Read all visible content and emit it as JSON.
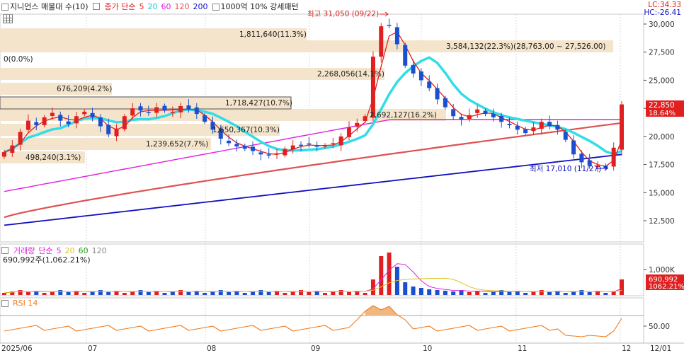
{
  "header": {
    "title": "지니언스 매물대 수(10)",
    "ma_prefix": "종가 단순",
    "ma_periods": [
      "5",
      "20",
      "60",
      "120",
      "200"
    ],
    "ma_colors": [
      "#e02020",
      "#22d0e0",
      "#e020e0",
      "#e05050",
      "#1010c0"
    ],
    "pattern_label": "1000억 10% 강세패턴"
  },
  "lc": "LC:34.33",
  "hc": "HC:-26.41",
  "price_axis": [
    "30,000",
    "27,500",
    "25,000",
    "22,500",
    "20,000",
    "17,500",
    "15,000",
    "12,500"
  ],
  "current_price": "22,850",
  "current_change": "18.64%",
  "high_annotation": "최고 31,050 (09/22)",
  "low_annotation": "최저 17,010 (11/27)",
  "volume_profile": [
    {
      "label": "1,811,640(11.3%)"
    },
    {
      "label": "3,584,132(22.3%)(28,763.00 ~ 27,526.00)"
    },
    {
      "label": "0(0.0%)"
    },
    {
      "label": "2,268,056(14.1%)"
    },
    {
      "label": "676,209(4.2%)"
    },
    {
      "label": "1,718,427(10.7%)"
    },
    {
      "label": "2,692,127(16.2%)"
    },
    {
      "label": "1,650,367(10.3%)"
    },
    {
      "label": "1,239,652(7.7%)"
    },
    {
      "label": "498,240(3.1%)"
    }
  ],
  "volume_panel": {
    "title": "거래량",
    "ma_prefix": "단순",
    "ma_periods": [
      "5",
      "20",
      "60",
      "120"
    ],
    "ma_colors": [
      "#e020e0",
      "#e0c020",
      "#20a020",
      "#888888"
    ],
    "summary": "690,992주(1,062.21%)",
    "axis_label": "1,000K",
    "current_value": "690,992",
    "current_pct": "1062.21%"
  },
  "rsi_panel": {
    "title": "RSI 14",
    "axis_label": "50.00"
  },
  "x_axis": [
    "2025/06",
    "07",
    "08",
    "09",
    "10",
    "11",
    "12",
    "12/01"
  ],
  "chart_data": {
    "type": "candlestick",
    "title": "지니언스",
    "ylim": [
      11000,
      31500
    ],
    "closes": [
      18600,
      19200,
      20400,
      21400,
      21000,
      21700,
      22100,
      21400,
      21100,
      21800,
      22200,
      21700,
      20900,
      20200,
      20700,
      21800,
      22500,
      22300,
      22100,
      22600,
      22300,
      22200,
      22700,
      22400,
      22000,
      21300,
      20600,
      19800,
      19400,
      19100,
      18900,
      18700,
      18400,
      18300,
      18500,
      18900,
      19200,
      19200,
      19300,
      19100,
      19200,
      19400,
      20000,
      20800,
      21200,
      21800,
      27100,
      29800,
      29900,
      28200,
      26300,
      25600,
      25000,
      24300,
      23300,
      22600,
      21800,
      21500,
      21900,
      22400,
      22000,
      21700,
      21300,
      21000,
      20600,
      20300,
      20800,
      21300,
      20900,
      20600,
      19700,
      18400,
      17700,
      17400,
      17400,
      17200,
      19000,
      22850
    ],
    "volume_profile_pct": [
      11.3,
      22.3,
      0.0,
      14.1,
      4.2,
      10.7,
      16.2,
      10.3,
      7.7,
      3.1
    ],
    "high": 31050,
    "low": 17010,
    "last_close": 22850,
    "last_volume": 690992
  }
}
